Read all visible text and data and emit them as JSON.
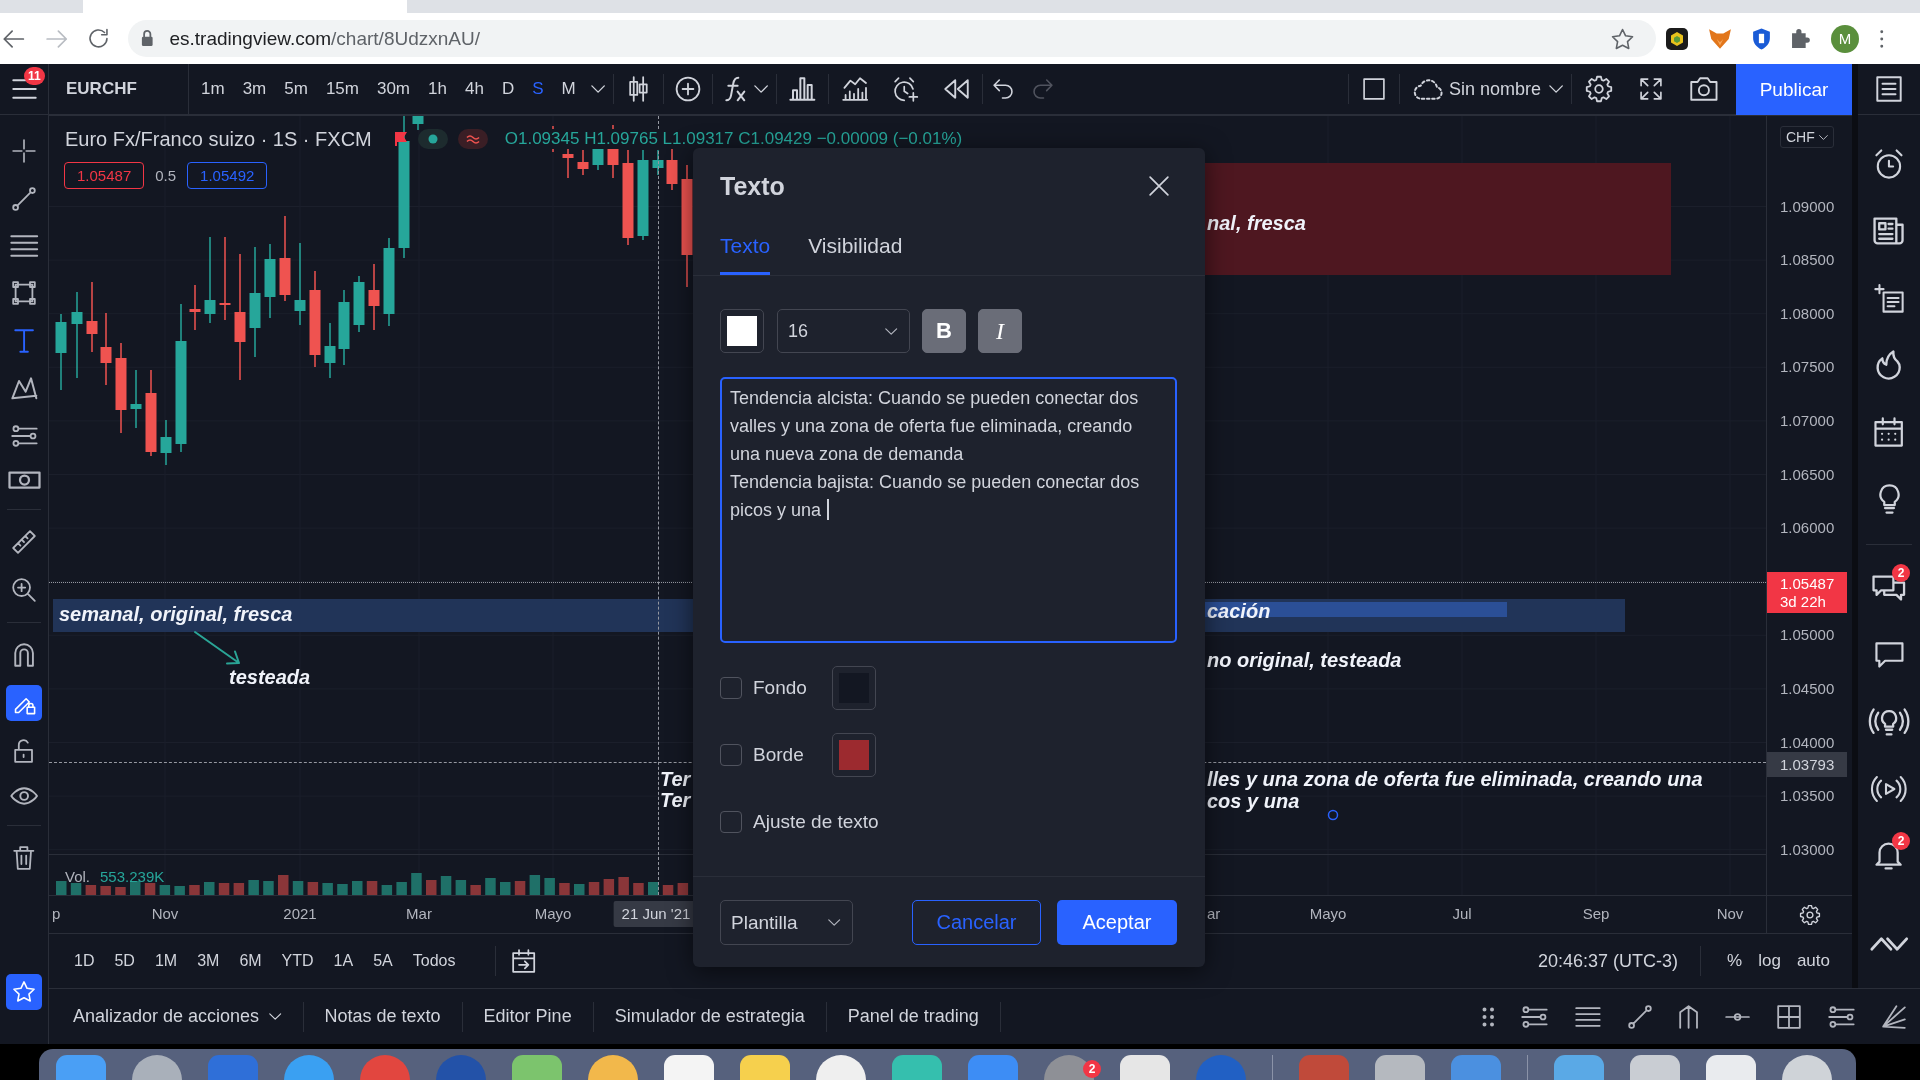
{
  "browser": {
    "address": {
      "host": "es.tradingview.com",
      "path": "/chart/8UdzxnAU/"
    },
    "profile_initial": "M"
  },
  "top_toolbar": {
    "menu_badge": "11",
    "symbol": "EURCHF",
    "intervals": [
      {
        "label": "1m",
        "selected": false
      },
      {
        "label": "3m",
        "selected": false
      },
      {
        "label": "5m",
        "selected": false
      },
      {
        "label": "15m",
        "selected": false
      },
      {
        "label": "30m",
        "selected": false
      },
      {
        "label": "1h",
        "selected": false
      },
      {
        "label": "4h",
        "selected": false
      },
      {
        "label": "D",
        "selected": false
      },
      {
        "label": "S",
        "selected": true
      },
      {
        "label": "M",
        "selected": false
      }
    ],
    "redo": {
      "disabled": true
    },
    "layout_name": "Sin nombre",
    "publish_button": "Publicar"
  },
  "left_toolbar": {
    "text_tool": {
      "selected": true
    },
    "drawing_lock": {
      "on": true
    },
    "favorites": {
      "on": true
    }
  },
  "chart": {
    "legend": {
      "title": "Euro Fx/Franco suizo · 1S · FXCM",
      "ohlc": "O1.09345 H1.09765 L1.09317 C1.09429 −0.00009 (−0.01%)",
      "sell_price": "1.05487",
      "spread": "0.5",
      "buy_price": "1.05492"
    },
    "annotations": [
      "nal, fresca",
      "semanal, original, fresca",
      "cación",
      "no original, testeada",
      "testeada",
      "Ter",
      "lles y una zona de oferta fue eliminada, creando una",
      "Ter",
      "cos y una"
    ],
    "volume": {
      "label": "Vol.",
      "value": "553.239K"
    },
    "price_axis": {
      "currency": "CHF",
      "labels": [
        "1.09000",
        "1.08500",
        "1.08000",
        "1.07500",
        "1.07000",
        "1.06500",
        "1.06000",
        "1.05000",
        "1.04500",
        "1.04000",
        "1.03500",
        "1.03000"
      ],
      "last_price": "1.05487",
      "countdown": "3d 22h",
      "crosshair_price": "1.03793"
    },
    "time_axis": {
      "labels": [
        "p",
        "Nov",
        "2021",
        "Mar",
        "Mayo",
        "ar",
        "Mayo",
        "Jul",
        "Sep",
        "Nov"
      ],
      "crosshair_date": "21 Jun '21"
    }
  },
  "range_bar": {
    "ranges": [
      "1D",
      "5D",
      "1M",
      "3M",
      "6M",
      "YTD",
      "1A",
      "5A",
      "Todos"
    ],
    "clock": "20:46:37 (UTC-3)",
    "scale_options": [
      "%",
      "log",
      "auto"
    ]
  },
  "right_sidebar": {
    "chat_badge": "2",
    "notifications_badge": "2"
  },
  "bottom_panel": {
    "tabs": [
      "Analizador de acciones",
      "Notas de texto",
      "Editor Pine",
      "Simulador de estrategia",
      "Panel de trading"
    ]
  },
  "dialog": {
    "title": "Texto",
    "tabs": [
      {
        "label": "Texto",
        "selected": true
      },
      {
        "label": "Visibilidad",
        "selected": false
      }
    ],
    "text_color": {
      "color": "#ffffff"
    },
    "size_dropdown": {
      "value": "16"
    },
    "bold_toggle": {
      "label": "B",
      "on": true
    },
    "italic_toggle": {
      "label": "I",
      "on": true
    },
    "text": "Tendencia alcista: Cuando se pueden conectar dos valles y una zona de oferta fue eliminada, creando una nueva zona de demanda\nTendencia bajista: Cuando se pueden conectar dos picos y una",
    "options": [
      {
        "label": "Fondo",
        "checked": false,
        "color": "#131722"
      },
      {
        "label": "Borde",
        "checked": false,
        "color": "#9c2a2f"
      },
      {
        "label": "Ajuste de texto",
        "checked": false
      }
    ],
    "template_dropdown": "Plantilla",
    "cancel_button": "Cancelar",
    "accept_button": "Aceptar"
  },
  "dock": {
    "badge": "2"
  }
}
